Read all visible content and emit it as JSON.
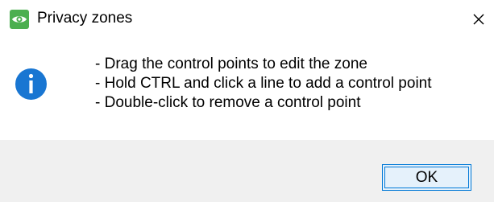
{
  "window": {
    "title": "Privacy zones",
    "app_icon": "eye-icon",
    "close_icon": "close-icon"
  },
  "message": {
    "icon": "info-icon",
    "lines": [
      "- Drag the control points to edit the zone",
      "- Hold CTRL and click a line to add a control point",
      "- Double-click to remove a control point"
    ]
  },
  "buttons": {
    "ok_label": "OK"
  },
  "colors": {
    "app_icon_green": "#4caf50",
    "info_blue": "#1976d2",
    "button_border": "#0078d7",
    "button_fill": "#e5f1fb",
    "footer_bg": "#f0f0f0"
  }
}
